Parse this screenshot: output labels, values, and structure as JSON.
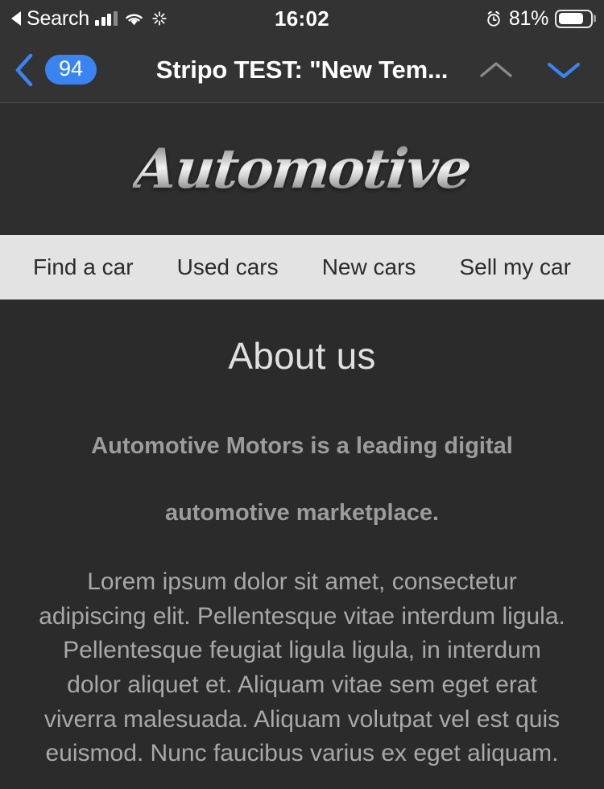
{
  "status_bar": {
    "back_label": "Search",
    "time": "16:02",
    "battery_percent": "81%",
    "battery_level": 81,
    "signal_icon": "cellular-signal-icon",
    "wifi_icon": "wifi-icon",
    "activity_icon": "activity-spinner-icon",
    "alarm_icon": "alarm-clock-icon",
    "battery_icon": "battery-icon"
  },
  "nav_bar": {
    "back_icon": "chevron-left-icon",
    "unread_count": "94",
    "title": "Stripo TEST: \"New Tem...",
    "prev_icon": "chevron-up-icon",
    "next_icon": "chevron-down-icon",
    "accent_color": "#3a84f2",
    "disabled_color": "#8a8a8a",
    "background_color": "#333333"
  },
  "email": {
    "header": {
      "logo_text": "Automotive",
      "background_color": "#2e2e2e"
    },
    "menu": {
      "background_color": "#e3e3e3",
      "items": [
        {
          "label": "Find a car"
        },
        {
          "label": "Used cars"
        },
        {
          "label": "New cars"
        },
        {
          "label": "Sell my car"
        }
      ]
    },
    "about": {
      "title": "About us",
      "lead": "Automotive Motors is a leading digital automotive marketplace.",
      "body": "Lorem ipsum dolor sit amet, consectetur adipiscing elit. Pellentesque vitae interdum ligula. Pellentesque feugiat ligula ligula, in interdum dolor aliquet et. Aliquam vitae sem eget erat viverra malesuada. Aliquam volutpat vel est quis euismod. Nunc faucibus varius ex eget aliquam.",
      "background_color": "#2b2b2b"
    }
  }
}
